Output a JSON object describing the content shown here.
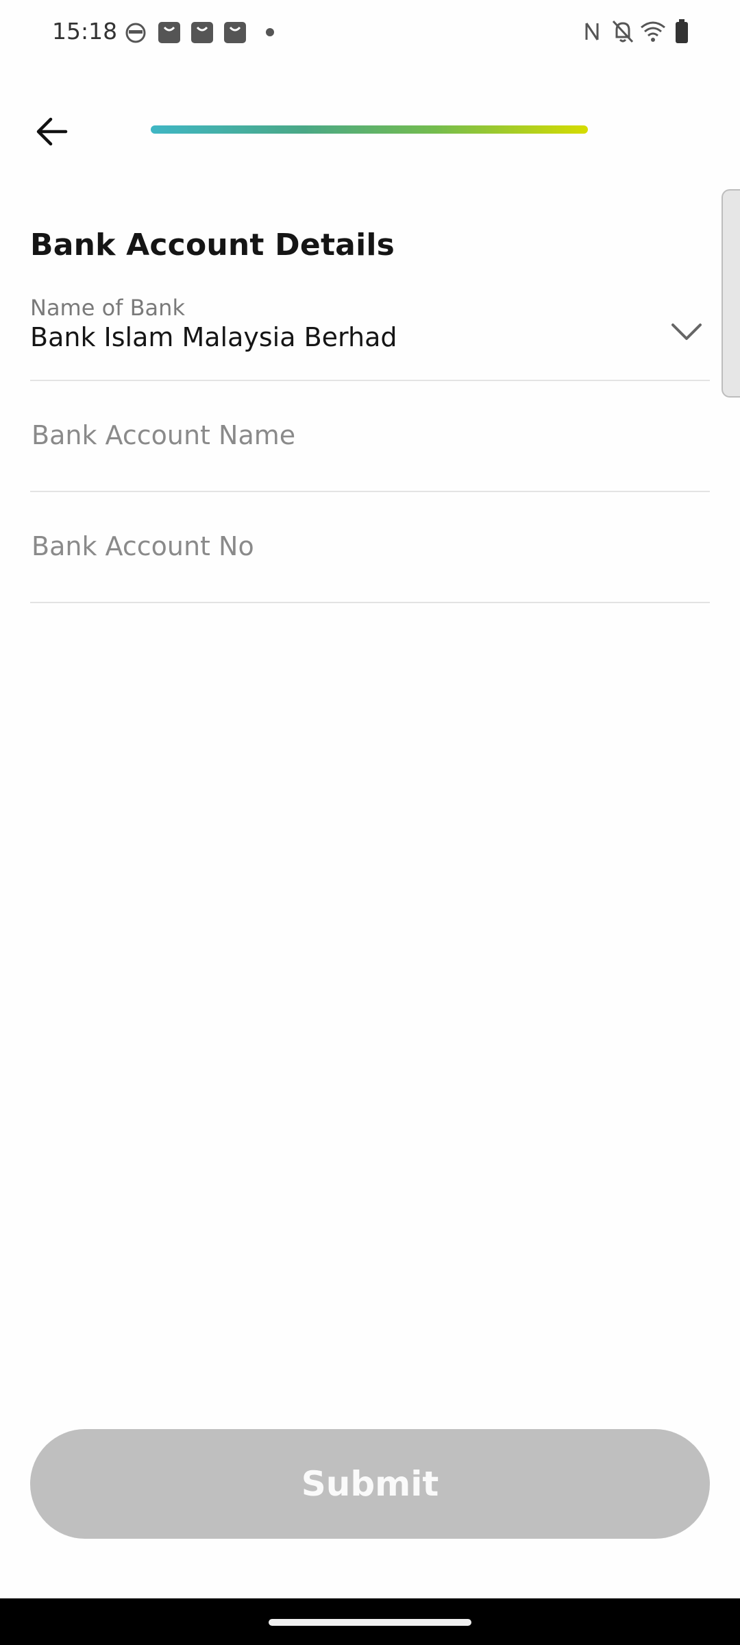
{
  "status_bar": {
    "time": "15:18",
    "left_icons": [
      "incognito-icon",
      "shopping-bag-icon",
      "shopping-bag-icon",
      "shopping-bag-icon",
      "notification-dot-icon"
    ],
    "right_icons": [
      "nfc-icon",
      "bell-off-icon",
      "wifi-icon",
      "battery-icon"
    ]
  },
  "header": {
    "back_icon": "arrow-left-icon",
    "progress": 1.0
  },
  "form": {
    "title": "Bank Account Details",
    "bank": {
      "label": "Name of Bank",
      "value": "Bank Islam Malaysia Berhad",
      "chevron_icon": "chevron-down-icon"
    },
    "account_name": {
      "placeholder": "Bank Account Name",
      "value": ""
    },
    "account_no": {
      "placeholder": "Bank Account No",
      "value": ""
    }
  },
  "submit": {
    "label": "Submit",
    "enabled": false
  },
  "colors": {
    "progress_start": "#3fb6c4",
    "progress_end": "#d6dc00",
    "submit_disabled_bg": "#bfbfbf",
    "text_primary": "#151515",
    "text_secondary": "#7a7a7a"
  }
}
